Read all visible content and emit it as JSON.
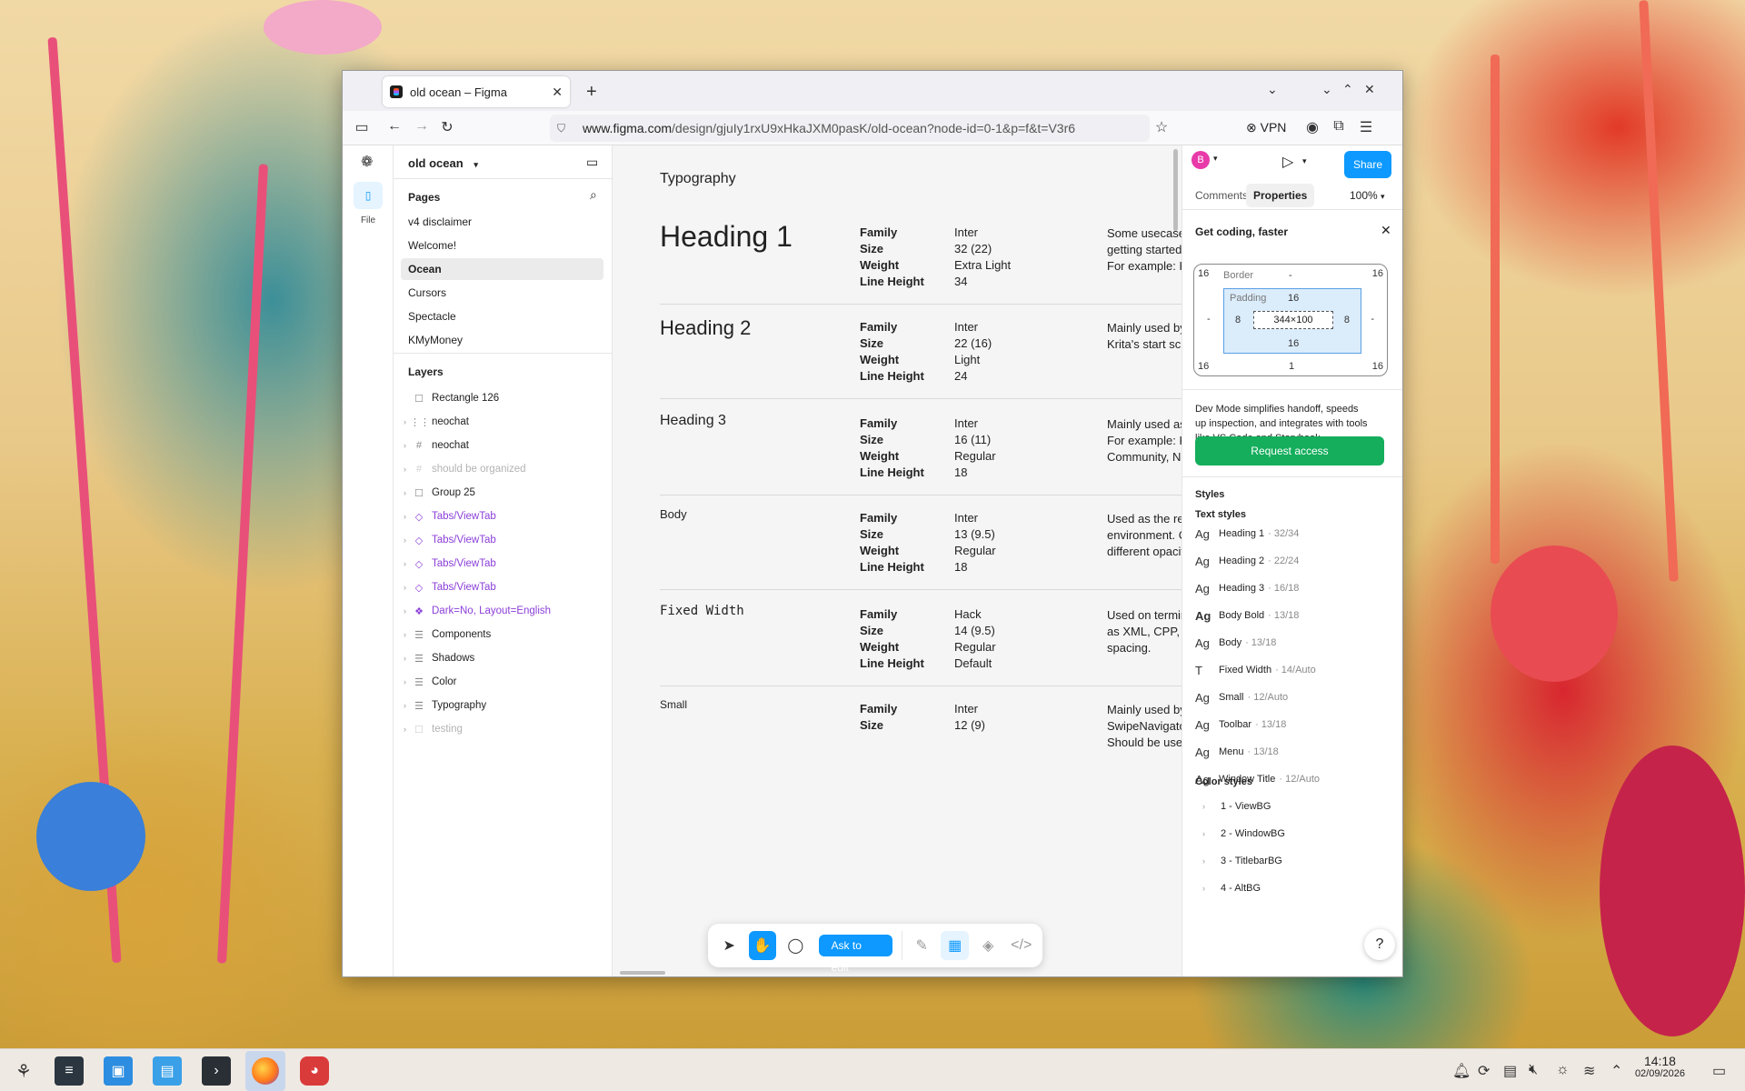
{
  "browser": {
    "tab_title": "old ocean – Figma",
    "url_host": "www.figma.com",
    "url_path": "/design/gjuIy1rxU9xHkaJXM0pasK/old-ocean?node-id=0-1&p=f&t=V3r6",
    "vpn_label": "VPN"
  },
  "rail": {
    "file_label": "File"
  },
  "file": {
    "name": "old ocean"
  },
  "pages": {
    "title": "Pages",
    "items": [
      "v4 disclaimer",
      "Welcome!",
      "Ocean",
      "Cursors",
      "Spectacle",
      "KMyMoney"
    ],
    "selected": "Ocean"
  },
  "layers": {
    "title": "Layers",
    "items": [
      {
        "name": "Rectangle 126",
        "icon": "rectangle-icon",
        "glyph": "☐",
        "kind": "normal"
      },
      {
        "name": "neochat",
        "icon": "autolayout-icon",
        "glyph": "⋮⋮",
        "kind": "normal"
      },
      {
        "name": "neochat",
        "icon": "frame-icon",
        "glyph": "#",
        "kind": "normal"
      },
      {
        "name": "should be organized",
        "icon": "frame-icon",
        "glyph": "#",
        "kind": "dim"
      },
      {
        "name": "Group 25",
        "icon": "group-icon",
        "glyph": "☐",
        "kind": "normal"
      },
      {
        "name": "Tabs/ViewTab",
        "icon": "instance-icon",
        "glyph": "◇",
        "kind": "comp"
      },
      {
        "name": "Tabs/ViewTab",
        "icon": "instance-icon",
        "glyph": "◇",
        "kind": "comp"
      },
      {
        "name": "Tabs/ViewTab",
        "icon": "instance-icon",
        "glyph": "◇",
        "kind": "comp"
      },
      {
        "name": "Tabs/ViewTab",
        "icon": "instance-icon",
        "glyph": "◇",
        "kind": "comp"
      },
      {
        "name": "Dark=No, Layout=English",
        "icon": "component-set-icon",
        "glyph": "❖",
        "kind": "comp"
      },
      {
        "name": "Components",
        "icon": "section-icon",
        "glyph": "☰",
        "kind": "normal"
      },
      {
        "name": "Shadows",
        "icon": "section-icon",
        "glyph": "☰",
        "kind": "normal"
      },
      {
        "name": "Color",
        "icon": "section-icon",
        "glyph": "☰",
        "kind": "normal"
      },
      {
        "name": "Typography",
        "icon": "section-icon",
        "glyph": "☰",
        "kind": "normal"
      },
      {
        "name": "testing",
        "icon": "frame-icon",
        "glyph": "☐",
        "kind": "dim"
      }
    ]
  },
  "canvas": {
    "title": "Typography",
    "keys": [
      "Family",
      "Size",
      "Weight",
      "Line Height"
    ],
    "specs": [
      {
        "name": "Heading 1",
        "values": [
          "Inter",
          "32 (22)",
          "Extra Light",
          "34"
        ],
        "desc": [
          "Some usecases would",
          "getting started app or",
          "For example: Kdevelop"
        ]
      },
      {
        "name": "Heading 2",
        "values": [
          "Inter",
          "22 (16)",
          "Light",
          "24"
        ],
        "desc": [
          "Mainly used by Kirigami",
          "Krita's start screen."
        ]
      },
      {
        "name": "Heading 3",
        "values": [
          "Inter",
          "16 (11)",
          "Regular",
          "18"
        ],
        "desc": [
          "Mainly used as compa",
          "For example: Kdevelop",
          "Community, News\""
        ]
      },
      {
        "name": "Body",
        "values": [
          "Inter",
          "13 (9.5)",
          "Regular",
          "18"
        ],
        "desc": [
          "Used as the regular te",
          "environment. Can be b",
          "different opacities of t"
        ]
      },
      {
        "name": "Fixed Width",
        "values": [
          "Hack",
          "14 (9.5)",
          "Regular",
          "Default"
        ],
        "desc": [
          "Used on terminal emu",
          "as XML, CPP, LaTeX, e",
          "spacing."
        ]
      },
      {
        "name": "Small",
        "values": [
          "Inter",
          "12 (9)"
        ],
        "desc": [
          "Mainly used by third-p",
          "SwipeNavigator and b",
          "Should be used used"
        ]
      }
    ]
  },
  "toolbar": {
    "ask_label": "Ask to edit"
  },
  "right": {
    "avatar": "B",
    "share_label": "Share",
    "tabs": [
      "Comments",
      "Properties"
    ],
    "zoom": "100%",
    "banner_title": "Get coding, faster",
    "box": {
      "border_label": "Border",
      "border_value": "-",
      "padding_label": "Padding",
      "margin_top_left": "16",
      "margin_top_right": "16",
      "margin_bottom_left": "16",
      "margin_bottom_right": "16",
      "margin_bottom": "1",
      "margin_left": "-",
      "margin_right": "-",
      "pad_top": "16",
      "pad_bottom": "16",
      "pad_left": "8",
      "pad_right": "8",
      "size": "344×100"
    },
    "devmode_text": [
      "Dev Mode simplifies handoff, speeds",
      "up inspection, and integrates with tools",
      "like VS Code and Storybook."
    ],
    "request_label": "Request access",
    "styles_title": "Styles",
    "text_styles_title": "Text styles",
    "text_styles": [
      {
        "glyph": "Ag",
        "name": "Heading 1",
        "sub": "· 32/34"
      },
      {
        "glyph": "Ag",
        "name": "Heading 2",
        "sub": "· 22/24"
      },
      {
        "glyph": "Ag",
        "name": "Heading 3",
        "sub": "· 16/18"
      },
      {
        "glyph": "Ag",
        "name": "Body Bold",
        "sub": "· 13/18"
      },
      {
        "glyph": "Ag",
        "name": "Body",
        "sub": "· 13/18"
      },
      {
        "glyph": "T",
        "name": "Fixed Width",
        "sub": "· 14/Auto"
      },
      {
        "glyph": "Ag",
        "name": "Small",
        "sub": "· 12/Auto"
      },
      {
        "glyph": "Ag",
        "name": "Toolbar",
        "sub": "· 13/18"
      },
      {
        "glyph": "Ag",
        "name": "Menu",
        "sub": "· 13/18"
      },
      {
        "glyph": "Ag",
        "name": "Window Title",
        "sub": "· 12/Auto"
      }
    ],
    "color_styles_title": "Color styles",
    "color_styles": [
      "1 - ViewBG",
      "2 - WindowBG",
      "3 - TitlebarBG",
      "4 - AltBG"
    ]
  },
  "taskbar": {
    "time": "14:18",
    "date": "02/09/2026"
  },
  "colors": {
    "figma_blue": "#0d99ff",
    "dev_green": "#14ae5c",
    "component_purple": "#8b3fd9"
  }
}
